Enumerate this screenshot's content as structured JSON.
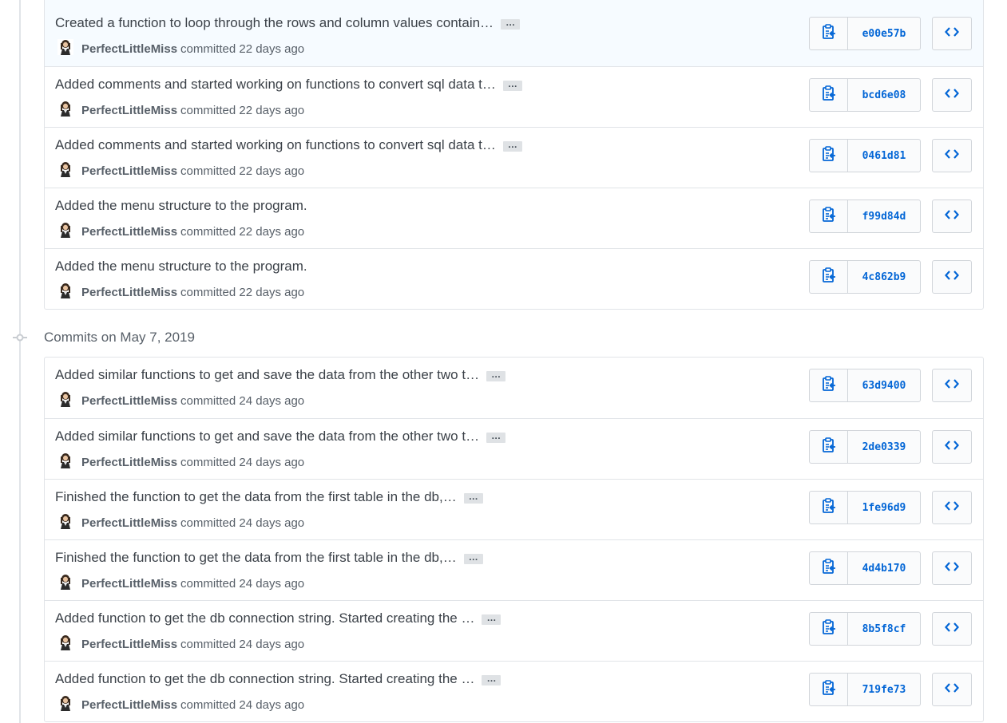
{
  "colors": {
    "accent": "#0366d6",
    "border": "#e1e4e8",
    "muted_text": "#586069",
    "highlight_row": "#f6fbff"
  },
  "icons": {
    "copy": "clippy-icon",
    "browse": "code-icon",
    "timeline": "git-commit-icon"
  },
  "groups": [
    {
      "date_label": "",
      "commits": [
        {
          "message": "Created a function to loop through the rows and column values contain…",
          "has_more": true,
          "ellipsis": "…",
          "author": "PerfectLittleMiss",
          "action": "committed",
          "when": "22 days ago",
          "sha": "e00e57b"
        },
        {
          "message": "Added comments and started working on functions to convert sql data t…",
          "has_more": true,
          "ellipsis": "…",
          "author": "PerfectLittleMiss",
          "action": "committed",
          "when": "22 days ago",
          "sha": "bcd6e08"
        },
        {
          "message": "Added comments and started working on functions to convert sql data t…",
          "has_more": true,
          "ellipsis": "…",
          "author": "PerfectLittleMiss",
          "action": "committed",
          "when": "22 days ago",
          "sha": "0461d81"
        },
        {
          "message": "Added the menu structure to the program.",
          "has_more": false,
          "ellipsis": "",
          "author": "PerfectLittleMiss",
          "action": "committed",
          "when": "22 days ago",
          "sha": "f99d84d"
        },
        {
          "message": "Added the menu structure to the program.",
          "has_more": false,
          "ellipsis": "",
          "author": "PerfectLittleMiss",
          "action": "committed",
          "when": "22 days ago",
          "sha": "4c862b9"
        }
      ]
    },
    {
      "date_label": "Commits on May 7, 2019",
      "commits": [
        {
          "message": "Added similar functions to get and save the data from the other two t…",
          "has_more": true,
          "ellipsis": "…",
          "author": "PerfectLittleMiss",
          "action": "committed",
          "when": "24 days ago",
          "sha": "63d9400"
        },
        {
          "message": "Added similar functions to get and save the data from the other two t…",
          "has_more": true,
          "ellipsis": "…",
          "author": "PerfectLittleMiss",
          "action": "committed",
          "when": "24 days ago",
          "sha": "2de0339"
        },
        {
          "message": "Finished the function to get the data from the first table in the db,…",
          "has_more": true,
          "ellipsis": "…",
          "author": "PerfectLittleMiss",
          "action": "committed",
          "when": "24 days ago",
          "sha": "1fe96d9"
        },
        {
          "message": "Finished the function to get the data from the first table in the db,…",
          "has_more": true,
          "ellipsis": "…",
          "author": "PerfectLittleMiss",
          "action": "committed",
          "when": "24 days ago",
          "sha": "4d4b170"
        },
        {
          "message": "Added function to get the db connection string. Started creating the …",
          "has_more": true,
          "ellipsis": "…",
          "author": "PerfectLittleMiss",
          "action": "committed",
          "when": "24 days ago",
          "sha": "8b5f8cf"
        },
        {
          "message": "Added function to get the db connection string. Started creating the …",
          "has_more": true,
          "ellipsis": "…",
          "author": "PerfectLittleMiss",
          "action": "committed",
          "when": "24 days ago",
          "sha": "719fe73"
        }
      ]
    }
  ]
}
